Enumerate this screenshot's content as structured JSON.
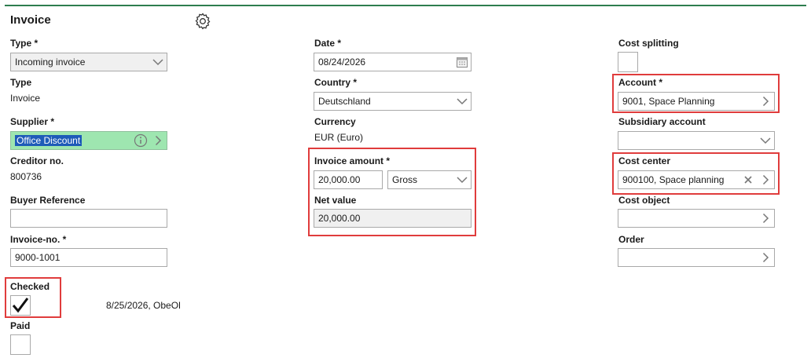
{
  "title": "Invoice",
  "left": {
    "type_label": "Type *",
    "type_value": "Incoming invoice",
    "type2_label": "Type",
    "type2_value": "Invoice",
    "supplier_label": "Supplier *",
    "supplier_value": "Office Discount",
    "creditor_label": "Creditor no.",
    "creditor_value": "800736",
    "buyer_label": "Buyer Reference",
    "buyer_value": "",
    "invoice_no_label": "Invoice-no. *",
    "invoice_no_value": "9000-1001",
    "checked_label": "Checked",
    "checked_info": "8/25/2026, ObeOl",
    "paid_label": "Paid"
  },
  "middle": {
    "date_label": "Date *",
    "date_value": "08/24/2026",
    "country_label": "Country *",
    "country_value": "Deutschland",
    "currency_label": "Currency",
    "currency_value": "EUR (Euro)",
    "amount_label": "Invoice amount *",
    "amount_value": "20,000.00",
    "amount_type": "Gross",
    "net_label": "Net value",
    "net_value": "20,000.00"
  },
  "right": {
    "cost_split_label": "Cost splitting",
    "account_label": "Account *",
    "account_value": "9001, Space Planning",
    "subsidiary_label": "Subsidiary account",
    "subsidiary_value": "",
    "cost_center_label": "Cost center",
    "cost_center_value": "900100, Space planning",
    "cost_object_label": "Cost object",
    "cost_object_value": "",
    "order_label": "Order",
    "order_value": ""
  },
  "colors": {
    "accent_line": "#2e7d4f",
    "highlight": "#e03c3c",
    "supplier_bg": "#9ee6b0"
  },
  "icons": [
    "gear-icon",
    "chevron-down-icon",
    "calendar-icon",
    "info-icon",
    "chevron-right-icon",
    "clear-icon",
    "checkmark-icon"
  ]
}
